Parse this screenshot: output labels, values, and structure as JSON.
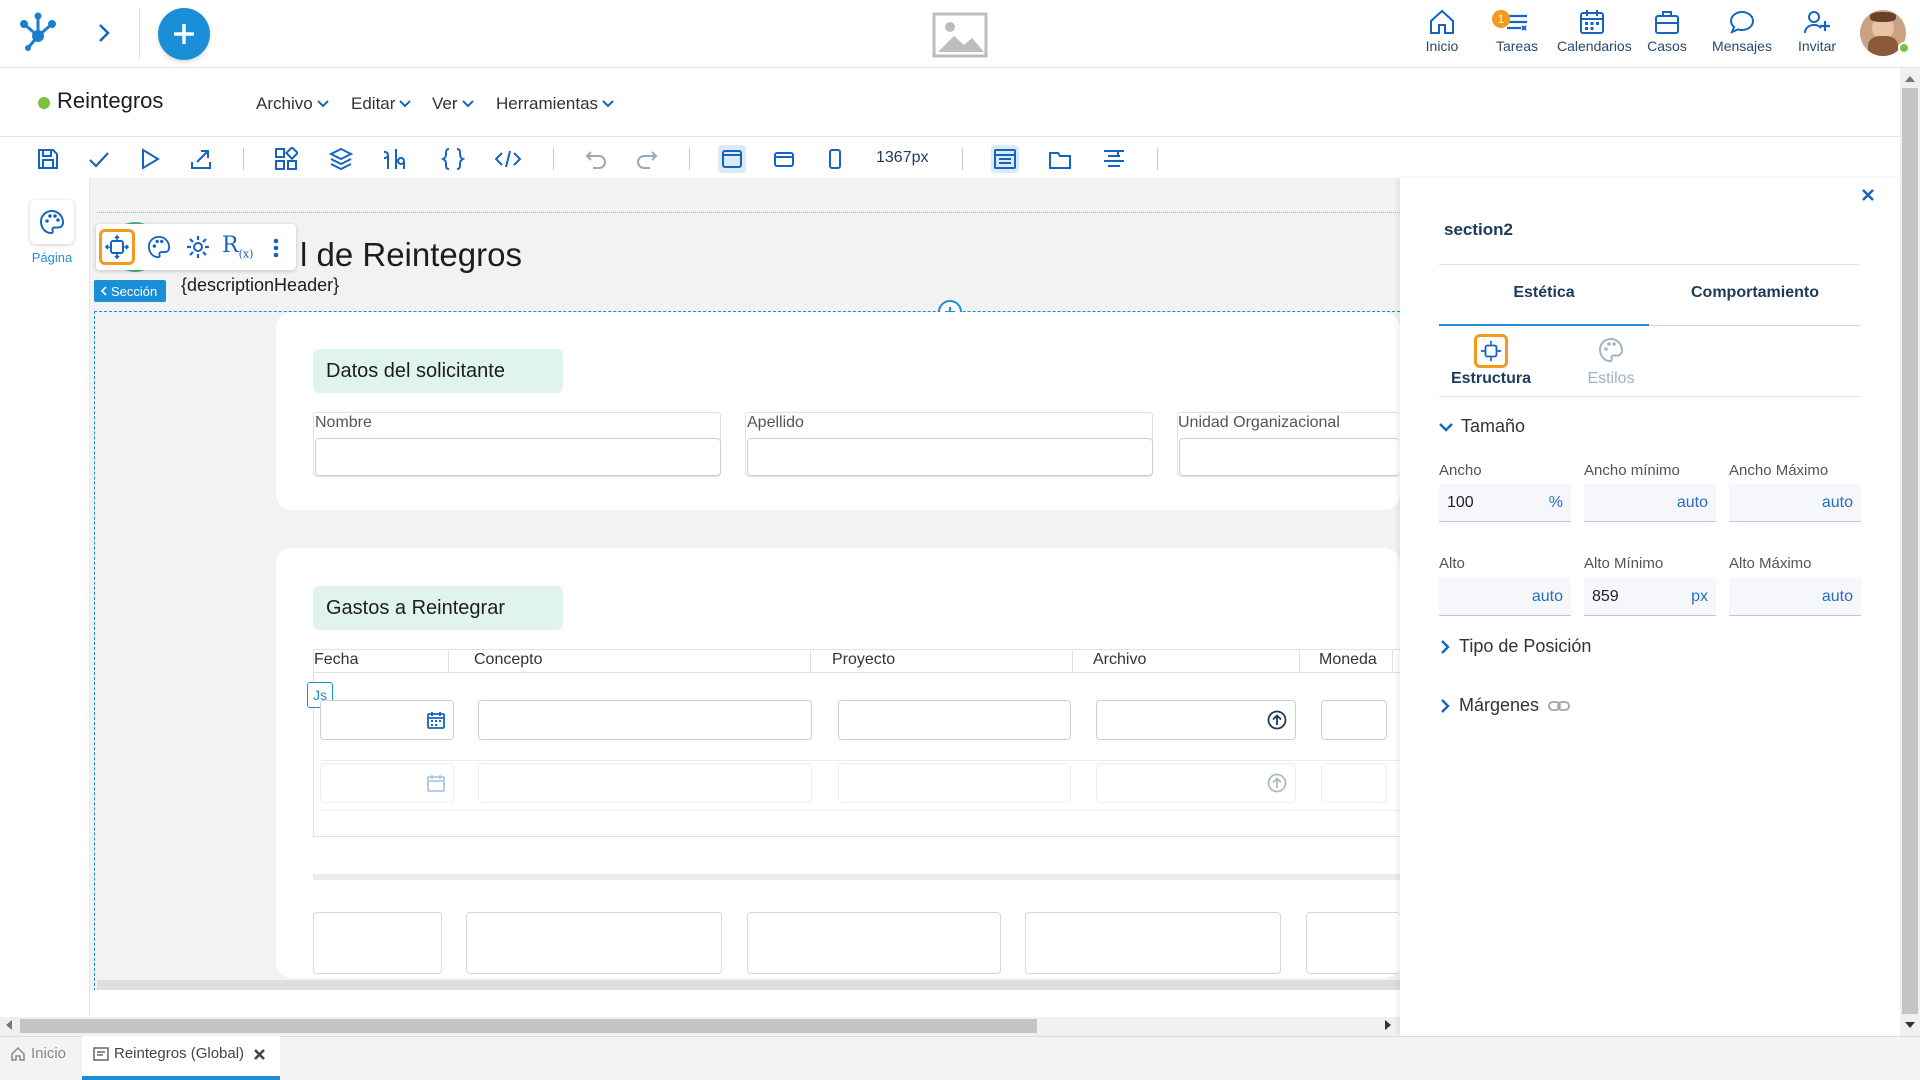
{
  "topbar": {
    "nav": [
      {
        "label": "Inicio",
        "icon": "home-icon"
      },
      {
        "label": "Tareas",
        "icon": "tasks-icon",
        "badge": "1"
      },
      {
        "label": "Calendarios",
        "icon": "calendar-icon"
      },
      {
        "label": "Casos",
        "icon": "briefcase-icon"
      },
      {
        "label": "Mensajes",
        "icon": "chat-icon"
      },
      {
        "label": "Invitar",
        "icon": "add-user-icon"
      }
    ]
  },
  "app": {
    "title": "Reintegros",
    "status_color": "#7cc242",
    "menus": [
      "Archivo",
      "Editar",
      "Ver",
      "Herramientas"
    ]
  },
  "toolbar": {
    "width_display": "1367px"
  },
  "left": {
    "page_label": "Página"
  },
  "form": {
    "title_fragment": "l de Reintegros",
    "description": "{descriptionHeader}",
    "section_tag": "Sección",
    "js_tag": "Js",
    "section1": {
      "title": "Datos del solicitante",
      "fields": [
        "Nombre",
        "Apellido",
        "Unidad Organizacional"
      ]
    },
    "section2": {
      "title": "Gastos a Reintegrar",
      "columns": [
        "Fecha",
        "Concepto",
        "Proyecto",
        "Archivo",
        "Moneda"
      ]
    }
  },
  "panel": {
    "element": "section2",
    "tabs": [
      "Estética",
      "Comportamiento"
    ],
    "subtabs": [
      "Estructura",
      "Estilos"
    ],
    "size_section": "Tamaño",
    "fields": {
      "ancho": {
        "label": "Ancho",
        "value": "100",
        "unit": "%"
      },
      "ancho_min": {
        "label": "Ancho mínimo",
        "value": "auto"
      },
      "ancho_max": {
        "label": "Ancho Máximo",
        "value": "auto"
      },
      "alto": {
        "label": "Alto",
        "value": "auto"
      },
      "alto_min": {
        "label": "Alto Mínimo",
        "value": "859",
        "unit": "px"
      },
      "alto_max": {
        "label": "Alto Máximo",
        "value": "auto"
      }
    },
    "position_section": "Tipo de Posición",
    "margins_section": "Márgenes"
  },
  "bottom_tabs": [
    {
      "label": "Inicio",
      "icon": "home-icon"
    },
    {
      "label": "Reintegros (Global)",
      "icon": "form-icon"
    }
  ],
  "colors": {
    "accent": "#1a8fd8",
    "brand_blue": "#1565c0",
    "highlight_orange": "#f39a1e",
    "chip_green": "#e0f4ee"
  }
}
